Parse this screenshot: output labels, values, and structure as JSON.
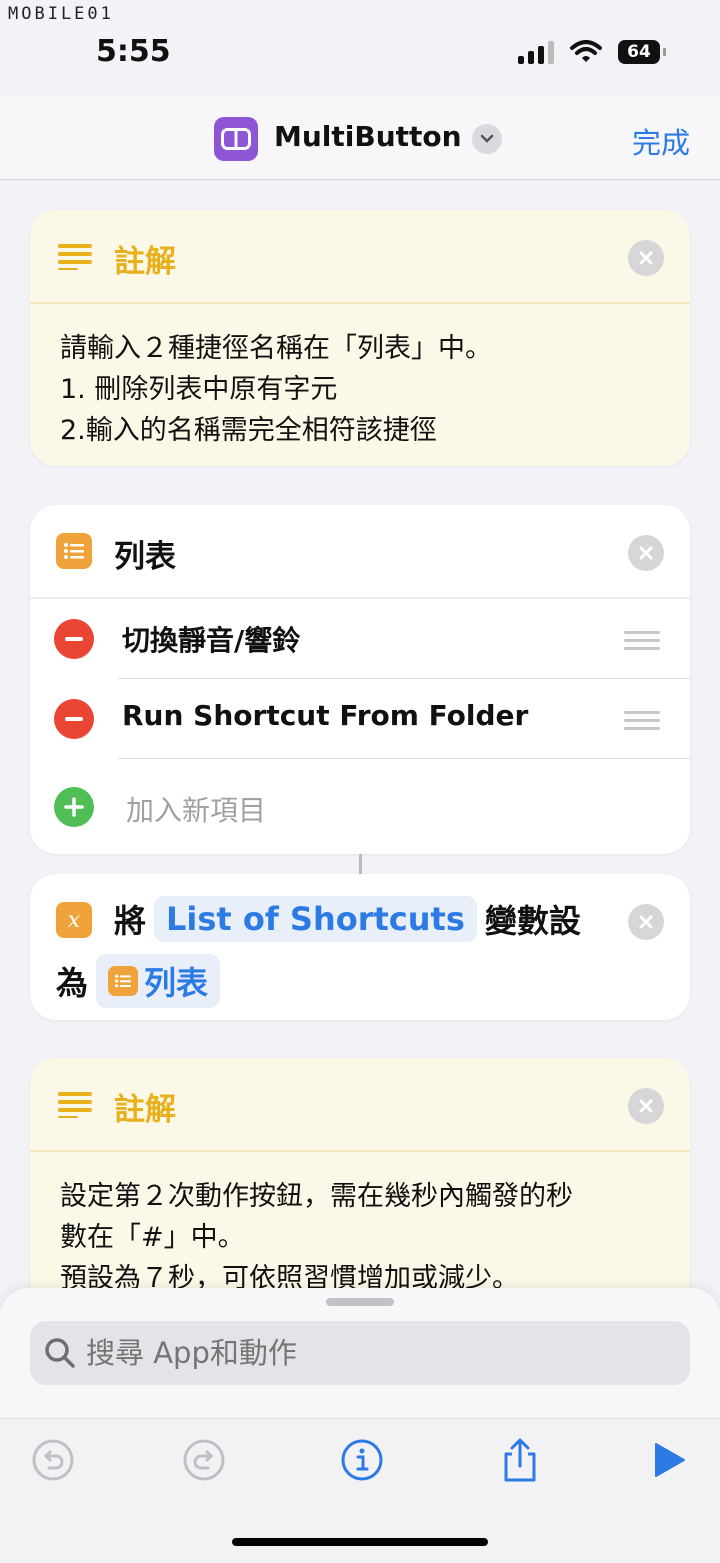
{
  "watermark": "MOBILE01",
  "status": {
    "time": "5:55",
    "battery": "64"
  },
  "header": {
    "title": "MultiButton",
    "done_label": "完成"
  },
  "comment1": {
    "title": "註解",
    "lines": [
      "請輸入２種捷徑名稱在「列表」中。",
      "1. 刪除列表中原有字元",
      "2.輸入的名稱需完全相符該捷徑"
    ]
  },
  "list": {
    "title": "列表",
    "items": [
      {
        "label": "切換靜音/響鈴"
      },
      {
        "label": "Run Shortcut From Folder"
      }
    ],
    "add_label": "加入新項目"
  },
  "set_variable": {
    "prefix": "將",
    "variable_name": "List of Shortcuts",
    "middle": "變數設",
    "line2_prefix": "為",
    "value_label": "列表"
  },
  "comment2": {
    "title": "註解",
    "lines": [
      "設定第２次動作按鈕，需在幾秒內觸發的秒",
      "數在「#」中。",
      "預設為７秒，可依照習慣增加或減少。"
    ]
  },
  "search": {
    "placeholder": "搜尋 App和動作"
  },
  "icons": {
    "app": "multibutton-icon",
    "comment": "text-lines-icon",
    "list": "list-icon",
    "variable": "variable-x-icon",
    "undo": "undo-icon",
    "redo": "redo-icon",
    "info": "info-icon",
    "share": "share-icon",
    "run": "play-icon"
  },
  "colors": {
    "accent": "#2c7be5",
    "comment_title": "#e8b01d",
    "delete": "#e94434",
    "add": "#4fbe55",
    "action_orange": "#f0a33a",
    "app_purple": "#8e55d4"
  }
}
